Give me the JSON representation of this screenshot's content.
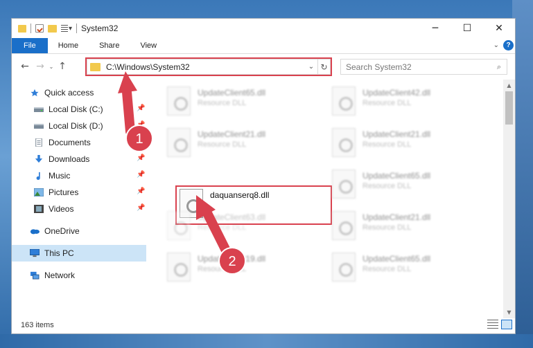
{
  "window": {
    "title": "System32",
    "controls": {
      "minimize": "─",
      "maximize": "☐",
      "close": "✕"
    }
  },
  "ribbon": {
    "tabs": [
      "File",
      "Home",
      "Share",
      "View"
    ],
    "chevron": "⌄",
    "help": "?"
  },
  "address": {
    "path": "C:\\Windows\\System32",
    "dropdown": "⌄",
    "refresh": "↻"
  },
  "nav_buttons": {
    "back": "←",
    "forward": "→",
    "recent": "⌄",
    "up": "↑"
  },
  "search": {
    "placeholder": "Search System32",
    "icon": "⌕"
  },
  "navigation": {
    "items": [
      {
        "label": "Quick access",
        "icon": "star-icon",
        "pinned": false
      },
      {
        "label": "Local Disk (C:)",
        "icon": "drive-icon",
        "pinned": true
      },
      {
        "label": "Local Disk (D:)",
        "icon": "drive-icon",
        "pinned": true
      },
      {
        "label": "Documents",
        "icon": "documents-icon",
        "pinned": true
      },
      {
        "label": "Downloads",
        "icon": "download-icon",
        "pinned": true
      },
      {
        "label": "Music",
        "icon": "music-icon",
        "pinned": true
      },
      {
        "label": "Pictures",
        "icon": "pictures-icon",
        "pinned": true
      },
      {
        "label": "Videos",
        "icon": "videos-icon",
        "pinned": true
      },
      {
        "label": "OneDrive",
        "icon": "cloud-icon",
        "pinned": false
      },
      {
        "label": "This PC",
        "icon": "computer-icon",
        "pinned": false,
        "selected": true
      },
      {
        "label": "Network",
        "icon": "network-icon",
        "pinned": false
      }
    ],
    "pin_glyph": "📌"
  },
  "files": [
    {
      "name": "UpdateClient65.dll",
      "type": "Resource DLL"
    },
    {
      "name": "UpdateClient42.dll",
      "type": "Resource DLL"
    },
    {
      "name": "UpdateClient21.dll",
      "type": "Resource DLL"
    },
    {
      "name": "UpdateClient21.dll",
      "type": "Resource DLL"
    },
    {
      "name": "daquanserq8.dll",
      "type": ""
    },
    {
      "name": "UpdateClient65.dll",
      "type": "Resource DLL"
    },
    {
      "name": "UpdateClient63.dll",
      "type": "Resource DLL"
    },
    {
      "name": "UpdateClient21.dll",
      "type": "Resource DLL"
    },
    {
      "name": "UpdateClient19.dll",
      "type": "Resource DLL"
    },
    {
      "name": "UpdateClient65.dll",
      "type": "Resource DLL"
    }
  ],
  "status": {
    "item_count": "163 items"
  },
  "annotations": {
    "step1": "1",
    "step2": "2",
    "color": "#d9414e"
  },
  "colors": {
    "accent": "#1a6fc9",
    "selection": "#cce4f7",
    "highlight": "#d9414e"
  }
}
